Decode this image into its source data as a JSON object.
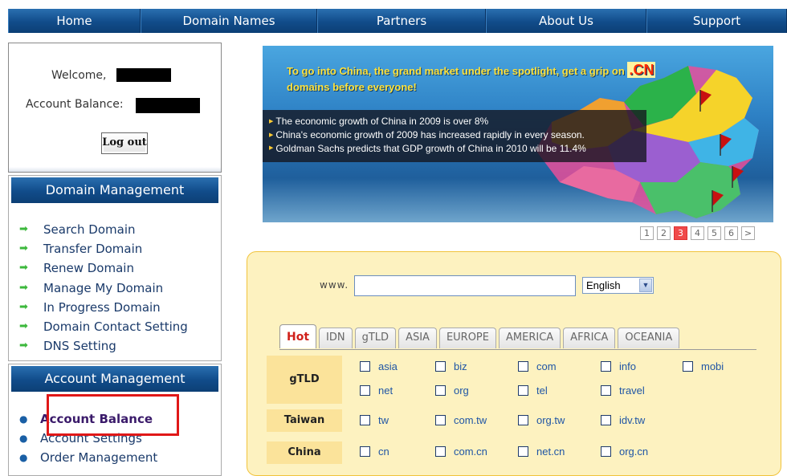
{
  "nav": {
    "items": [
      "Home",
      "Domain Names",
      "Partners",
      "About Us",
      "Support"
    ]
  },
  "account": {
    "welcome_label": "Welcome,",
    "balance_label": "Account Balance:",
    "logout_label": "Log out"
  },
  "domain_management": {
    "title": "Domain Management",
    "items": [
      "Search Domain",
      "Transfer Domain",
      "Renew Domain",
      "Manage My Domain",
      "In Progress Domain",
      "Domain Contact Setting",
      "DNS Setting"
    ]
  },
  "account_management": {
    "title": "Account Management",
    "items": [
      "Account Balance",
      "Account Settings",
      "Order Management"
    ]
  },
  "banner": {
    "headline": "To go into China, the grand market under the spotlight, get a grip on ",
    "headline_cn": ".CN",
    "headline_tail": "domains before everyone!",
    "points": [
      "The economic growth of China in 2009 is over 8%",
      "China's economic growth of 2009 has increased rapidly in every season.",
      "Goldman Sachs predicts that GDP growth of China in 2010 will be 11.4%"
    ]
  },
  "pager": {
    "pages": [
      "1",
      "2",
      "3",
      "4",
      "5",
      "6",
      ">"
    ],
    "active_page": 3
  },
  "search": {
    "www_label": "www.",
    "input_value": "",
    "language": "English",
    "tabs": [
      "Hot",
      "IDN",
      "gTLD",
      "ASIA",
      "EUROPE",
      "AMERICA",
      "AFRICA",
      "OCEANIA"
    ],
    "active_tab": "Hot",
    "categories": [
      {
        "label": "gTLD",
        "extensions": [
          "asia",
          "biz",
          "com",
          "info",
          "mobi",
          "net",
          "org",
          "tel",
          "travel"
        ]
      },
      {
        "label": "Taiwan",
        "extensions": [
          "tw",
          "com.tw",
          "org.tw",
          "idv.tw"
        ]
      },
      {
        "label": "China",
        "extensions": [
          "cn",
          "com.cn",
          "net.cn",
          "org.cn"
        ]
      }
    ]
  },
  "colors": {
    "nav_blue": "#114c8a",
    "panel_yellow": "#fdf2c0",
    "highlight_red": "#e01818",
    "active_tab_red": "#d0201a"
  }
}
